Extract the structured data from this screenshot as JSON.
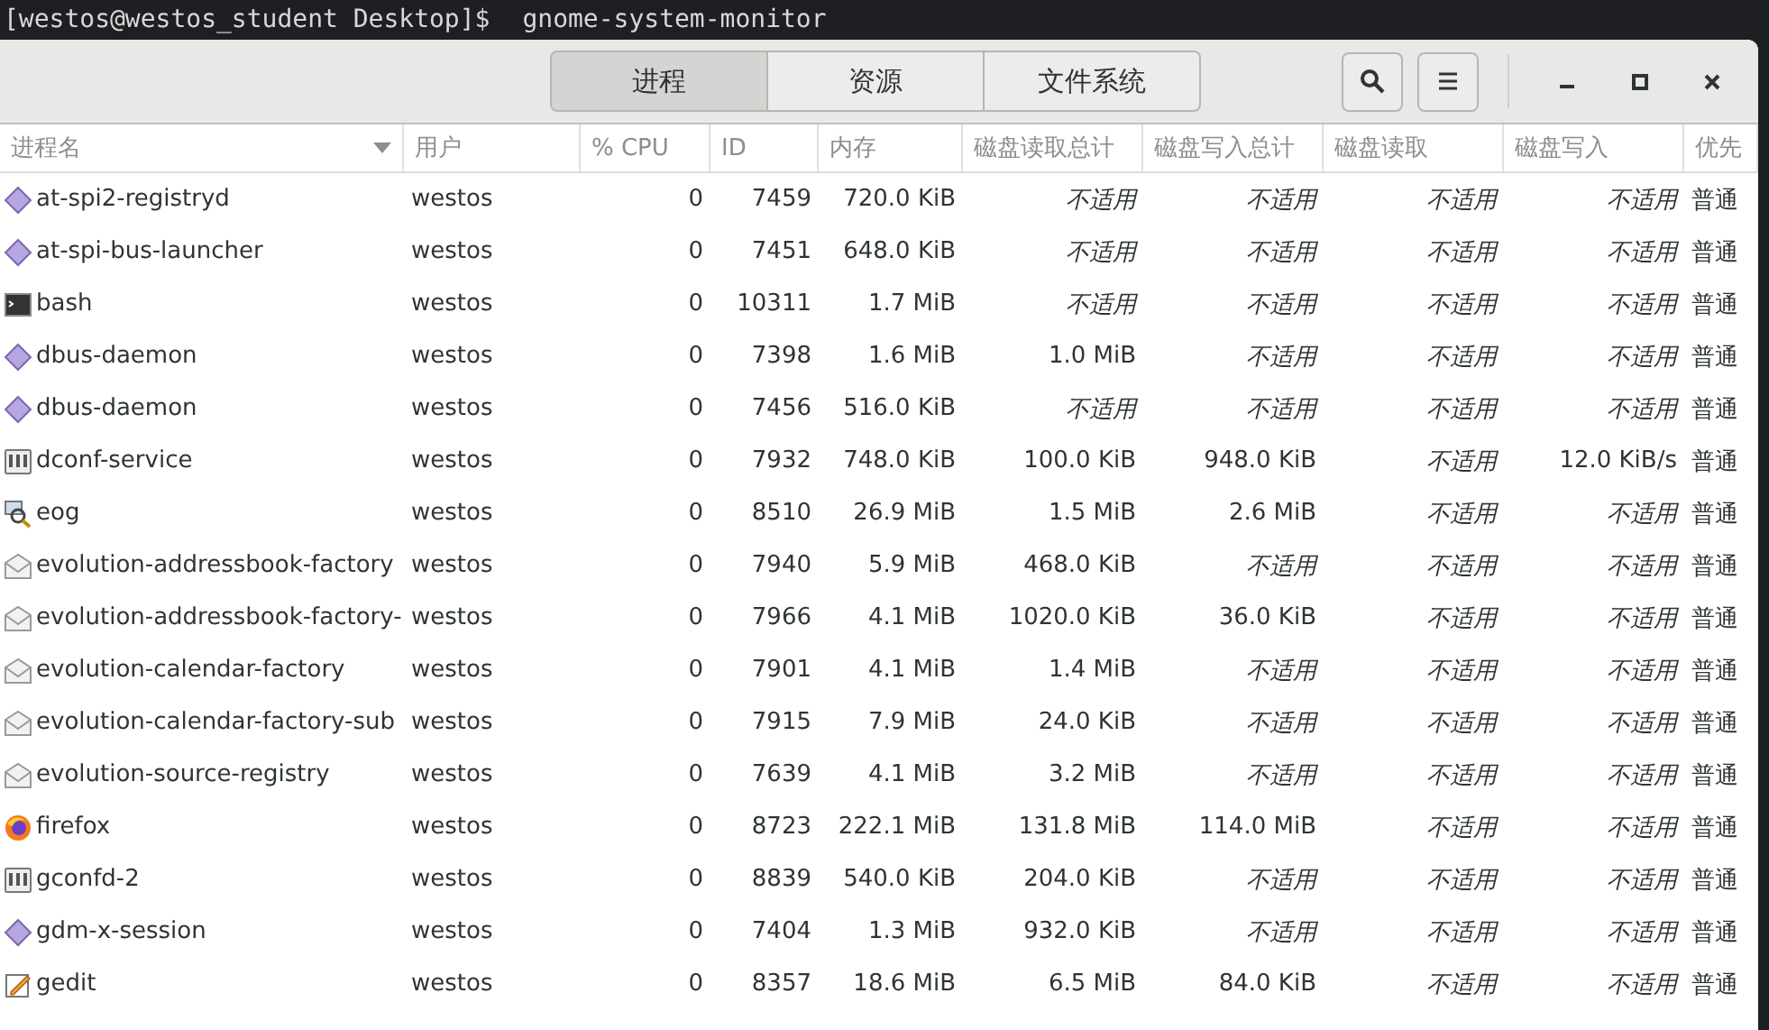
{
  "terminal": {
    "prompt": "[westos@westos_student Desktop]$",
    "command": "gnome-system-monitor"
  },
  "tabs": [
    {
      "label": "进程",
      "selected": true
    },
    {
      "label": "资源",
      "selected": false
    },
    {
      "label": "文件系统",
      "selected": false
    }
  ],
  "table": {
    "columns": [
      {
        "label": "进程名",
        "sorted": true
      },
      {
        "label": "用户",
        "sorted": false
      },
      {
        "label": "% CPU",
        "sorted": false
      },
      {
        "label": "ID",
        "sorted": false
      },
      {
        "label": "内存",
        "sorted": false
      },
      {
        "label": "磁盘读取总计",
        "sorted": false
      },
      {
        "label": "磁盘写入总计",
        "sorted": false
      },
      {
        "label": "磁盘读取",
        "sorted": false
      },
      {
        "label": "磁盘写入",
        "sorted": false
      },
      {
        "label": "优先",
        "sorted": false
      }
    ],
    "rows": [
      {
        "kind": "generic",
        "name": "at-spi2-registryd",
        "user": "westos",
        "cpu": "0",
        "id": "7459",
        "memory": "720.0 KiB",
        "disk": [
          {
            "text": "不适用",
            "kind": "na"
          },
          {
            "text": "不适用",
            "kind": "na"
          },
          {
            "text": "不适用",
            "kind": "na"
          },
          {
            "text": "不适用",
            "kind": "na"
          }
        ],
        "priority": "普通"
      },
      {
        "kind": "generic",
        "name": "at-spi-bus-launcher",
        "user": "westos",
        "cpu": "0",
        "id": "7451",
        "memory": "648.0 KiB",
        "disk": [
          {
            "text": "不适用",
            "kind": "na"
          },
          {
            "text": "不适用",
            "kind": "na"
          },
          {
            "text": "不适用",
            "kind": "na"
          },
          {
            "text": "不适用",
            "kind": "na"
          }
        ],
        "priority": "普通"
      },
      {
        "kind": "terminal",
        "name": "bash",
        "user": "westos",
        "cpu": "0",
        "id": "10311",
        "memory": "1.7 MiB",
        "disk": [
          {
            "text": "不适用",
            "kind": "na"
          },
          {
            "text": "不适用",
            "kind": "na"
          },
          {
            "text": "不适用",
            "kind": "na"
          },
          {
            "text": "不适用",
            "kind": "na"
          }
        ],
        "priority": "普通"
      },
      {
        "kind": "generic",
        "name": "dbus-daemon",
        "user": "westos",
        "cpu": "0",
        "id": "7398",
        "memory": "1.6 MiB",
        "disk": [
          {
            "text": "1.0 MiB",
            "kind": "value"
          },
          {
            "text": "不适用",
            "kind": "na"
          },
          {
            "text": "不适用",
            "kind": "na"
          },
          {
            "text": "不适用",
            "kind": "na"
          }
        ],
        "priority": "普通"
      },
      {
        "kind": "generic",
        "name": "dbus-daemon",
        "user": "westos",
        "cpu": "0",
        "id": "7456",
        "memory": "516.0 KiB",
        "disk": [
          {
            "text": "不适用",
            "kind": "na"
          },
          {
            "text": "不适用",
            "kind": "na"
          },
          {
            "text": "不适用",
            "kind": "na"
          },
          {
            "text": "不适用",
            "kind": "na"
          }
        ],
        "priority": "普通"
      },
      {
        "kind": "config",
        "name": "dconf-service",
        "user": "westos",
        "cpu": "0",
        "id": "7932",
        "memory": "748.0 KiB",
        "disk": [
          {
            "text": "100.0 KiB",
            "kind": "value"
          },
          {
            "text": "948.0 KiB",
            "kind": "value"
          },
          {
            "text": "不适用",
            "kind": "na"
          },
          {
            "text": "12.0 KiB/s",
            "kind": "value"
          }
        ],
        "priority": "普通"
      },
      {
        "kind": "viewer",
        "name": "eog",
        "user": "westos",
        "cpu": "0",
        "id": "8510",
        "memory": "26.9 MiB",
        "disk": [
          {
            "text": "1.5 MiB",
            "kind": "value"
          },
          {
            "text": "2.6 MiB",
            "kind": "value"
          },
          {
            "text": "不适用",
            "kind": "na"
          },
          {
            "text": "不适用",
            "kind": "na"
          }
        ],
        "priority": "普通"
      },
      {
        "kind": "mail",
        "name": "evolution-addressbook-factory",
        "user": "westos",
        "cpu": "0",
        "id": "7940",
        "memory": "5.9 MiB",
        "disk": [
          {
            "text": "468.0 KiB",
            "kind": "value"
          },
          {
            "text": "不适用",
            "kind": "na"
          },
          {
            "text": "不适用",
            "kind": "na"
          },
          {
            "text": "不适用",
            "kind": "na"
          }
        ],
        "priority": "普通"
      },
      {
        "kind": "mail",
        "name": "evolution-addressbook-factory-",
        "user": "westos",
        "cpu": "0",
        "id": "7966",
        "memory": "4.1 MiB",
        "disk": [
          {
            "text": "1020.0 KiB",
            "kind": "value"
          },
          {
            "text": "36.0 KiB",
            "kind": "value"
          },
          {
            "text": "不适用",
            "kind": "na"
          },
          {
            "text": "不适用",
            "kind": "na"
          }
        ],
        "priority": "普通"
      },
      {
        "kind": "mail",
        "name": "evolution-calendar-factory",
        "user": "westos",
        "cpu": "0",
        "id": "7901",
        "memory": "4.1 MiB",
        "disk": [
          {
            "text": "1.4 MiB",
            "kind": "value"
          },
          {
            "text": "不适用",
            "kind": "na"
          },
          {
            "text": "不适用",
            "kind": "na"
          },
          {
            "text": "不适用",
            "kind": "na"
          }
        ],
        "priority": "普通"
      },
      {
        "kind": "mail",
        "name": "evolution-calendar-factory-sub",
        "user": "westos",
        "cpu": "0",
        "id": "7915",
        "memory": "7.9 MiB",
        "disk": [
          {
            "text": "24.0 KiB",
            "kind": "value"
          },
          {
            "text": "不适用",
            "kind": "na"
          },
          {
            "text": "不适用",
            "kind": "na"
          },
          {
            "text": "不适用",
            "kind": "na"
          }
        ],
        "priority": "普通"
      },
      {
        "kind": "mail",
        "name": "evolution-source-registry",
        "user": "westos",
        "cpu": "0",
        "id": "7639",
        "memory": "4.1 MiB",
        "disk": [
          {
            "text": "3.2 MiB",
            "kind": "value"
          },
          {
            "text": "不适用",
            "kind": "na"
          },
          {
            "text": "不适用",
            "kind": "na"
          },
          {
            "text": "不适用",
            "kind": "na"
          }
        ],
        "priority": "普通"
      },
      {
        "kind": "browser",
        "name": "firefox",
        "user": "westos",
        "cpu": "0",
        "id": "8723",
        "memory": "222.1 MiB",
        "disk": [
          {
            "text": "131.8 MiB",
            "kind": "value"
          },
          {
            "text": "114.0 MiB",
            "kind": "value"
          },
          {
            "text": "不适用",
            "kind": "na"
          },
          {
            "text": "不适用",
            "kind": "na"
          }
        ],
        "priority": "普通"
      },
      {
        "kind": "config",
        "name": "gconfd-2",
        "user": "westos",
        "cpu": "0",
        "id": "8839",
        "memory": "540.0 KiB",
        "disk": [
          {
            "text": "204.0 KiB",
            "kind": "value"
          },
          {
            "text": "不适用",
            "kind": "na"
          },
          {
            "text": "不适用",
            "kind": "na"
          },
          {
            "text": "不适用",
            "kind": "na"
          }
        ],
        "priority": "普通"
      },
      {
        "kind": "generic",
        "name": "gdm-x-session",
        "user": "westos",
        "cpu": "0",
        "id": "7404",
        "memory": "1.3 MiB",
        "disk": [
          {
            "text": "932.0 KiB",
            "kind": "value"
          },
          {
            "text": "不适用",
            "kind": "na"
          },
          {
            "text": "不适用",
            "kind": "na"
          },
          {
            "text": "不适用",
            "kind": "na"
          }
        ],
        "priority": "普通"
      },
      {
        "kind": "editor",
        "name": "gedit",
        "user": "westos",
        "cpu": "0",
        "id": "8357",
        "memory": "18.6 MiB",
        "disk": [
          {
            "text": "6.5 MiB",
            "kind": "value"
          },
          {
            "text": "84.0 KiB",
            "kind": "value"
          },
          {
            "text": "不适用",
            "kind": "na"
          },
          {
            "text": "不适用",
            "kind": "na"
          }
        ],
        "priority": "普通"
      }
    ]
  }
}
